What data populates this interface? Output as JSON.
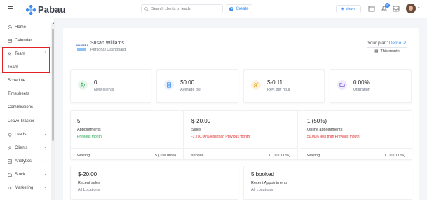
{
  "app": {
    "name": "Pabau"
  },
  "topbar": {
    "search_placeholder": "Search clients or leads",
    "create_label": "Create",
    "views_label": "Views",
    "notification_count": "6"
  },
  "sidebar": {
    "items": [
      {
        "label": "Home",
        "icon": "home-icon"
      },
      {
        "label": "Calendar",
        "icon": "calendar-icon"
      },
      {
        "label": "Team",
        "icon": "team-icon"
      },
      {
        "label": "Team"
      },
      {
        "label": "Schedule"
      },
      {
        "label": "Timesheets"
      },
      {
        "label": "Commissions"
      },
      {
        "label": "Leave Tracker"
      },
      {
        "label": "Leads",
        "icon": "leads-icon"
      },
      {
        "label": "Clients",
        "icon": "clients-icon"
      },
      {
        "label": "Analytics",
        "icon": "analytics-icon"
      },
      {
        "label": "Stock",
        "icon": "stock-icon"
      },
      {
        "label": "Marketing",
        "icon": "marketing-icon"
      }
    ]
  },
  "header": {
    "logo_text": "WAMEBA",
    "name": "Susan Williams",
    "subtitle": "Personal Dashboard",
    "plan_label": "Your plan:",
    "plan_value": "Demo",
    "period": "This month"
  },
  "stats": [
    {
      "value": "0",
      "label": "New clients",
      "color": "#e8f6ee",
      "icon": "new-clients-icon"
    },
    {
      "value": "$0.00",
      "label": "Average bill",
      "color": "#e6f1fd",
      "icon": "bill-icon"
    },
    {
      "value": "$-0.11",
      "label": "Rev. per hour",
      "color": "#fdf3e1",
      "icon": "revenue-icon"
    },
    {
      "value": "0.00%",
      "label": "Utilization",
      "color": "#efeafc",
      "icon": "utilization-icon"
    }
  ],
  "metrics": [
    {
      "value": "5",
      "label": "Appointments",
      "sub": "Previous month",
      "sub_status": "green",
      "foot_label": "Waiting",
      "foot_value": "5 (100.00%)"
    },
    {
      "value": "$-20.00",
      "label": "Sales",
      "sub": "-1,750.00% less than Previous month",
      "sub_status": "red",
      "foot_label": "service",
      "foot_value": "0 (100.00%)"
    },
    {
      "value": "1 (50%)",
      "label": "Online appointments",
      "sub": "50.00% less than Previous month",
      "sub_status": "red",
      "foot_label": "Waiting",
      "foot_value": "1 (100.00%)"
    }
  ],
  "bottom": [
    {
      "value": "$-20.00",
      "label": "Recent sales",
      "location": "All Locations"
    },
    {
      "value": "5 booked",
      "label": "Recent Appointments",
      "location": "All Locations"
    }
  ],
  "colors": {
    "accent": "#3f8ef0",
    "highlight": "#e02424",
    "green": "#1fa14b"
  }
}
